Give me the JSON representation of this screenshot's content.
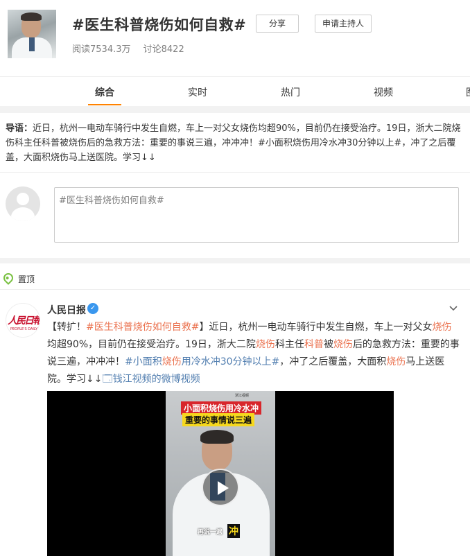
{
  "header": {
    "title": "#医生科普烧伤如何自救#",
    "share_label": "分享",
    "host_label": "申请主持人",
    "reads": "阅读7534.3万",
    "discussions": "讨论8422"
  },
  "tabs": [
    {
      "label": "综合",
      "active": true
    },
    {
      "label": "实时",
      "active": false
    },
    {
      "label": "热门",
      "active": false
    },
    {
      "label": "视频",
      "active": false
    },
    {
      "label": "图",
      "active": false
    }
  ],
  "intro": {
    "label": "导语：",
    "text": "近日，杭州一电动车骑行中发生自燃，车上一对父女烧伤均超90%，目前仍在接受治疗。19日，浙大二院烧伤科主任科普被烧伤后的急救方法：重要的事说三遍，冲冲冲！#小面积烧伤用冷水冲30分钟以上#，冲了之后覆盖，大面积烧伤马上送医院。学习↓↓"
  },
  "composer": {
    "prefill": "#医生科普烧伤如何自救#"
  },
  "pinned": {
    "label": "置顶"
  },
  "post": {
    "author": "人民日报",
    "avatar_logo_text": "人民日報",
    "avatar_logo_sub": "PEOPLE'S DAILY",
    "segments": [
      {
        "t": "【转扩！",
        "c": "n"
      },
      {
        "t": "#医生科普烧伤如何自救#",
        "c": "hl"
      },
      {
        "t": "】近日，杭州一电动车骑行中发生自燃，车上一对父女",
        "c": "n"
      },
      {
        "t": "烧伤",
        "c": "hl"
      },
      {
        "t": "均超90%，目前仍在接受治疗。19日，浙大二院",
        "c": "n"
      },
      {
        "t": "烧伤",
        "c": "hl"
      },
      {
        "t": "科主任",
        "c": "n"
      },
      {
        "t": "科普",
        "c": "hl"
      },
      {
        "t": "被",
        "c": "n"
      },
      {
        "t": "烧伤",
        "c": "hl"
      },
      {
        "t": "后的急救方法：重要的事说三遍，冲冲冲！",
        "c": "n"
      },
      {
        "t": "#小面积",
        "c": "tag"
      },
      {
        "t": "烧伤",
        "c": "hl"
      },
      {
        "t": "用冷水冲30分钟以上#",
        "c": "tag"
      },
      {
        "t": "，冲了之后覆盖，大面积",
        "c": "n"
      },
      {
        "t": "烧伤",
        "c": "hl"
      },
      {
        "t": "马上送医院。学习↓↓",
        "c": "n"
      },
      {
        "t": "🗔钱江视频的微博视频",
        "c": "tag"
      }
    ],
    "video": {
      "caption_line1": "小面积烧伤用冷水冲",
      "caption_line2": "重要的事情说三遍",
      "brand": "浙江视频",
      "subtitle": "再说一遍",
      "subtitle_big": "冲"
    }
  },
  "colors": {
    "accent": "#ff8200",
    "highlight": "#eb7350",
    "link": "#507daf",
    "verified": "#3a97ee",
    "pin": "#7ac142"
  }
}
